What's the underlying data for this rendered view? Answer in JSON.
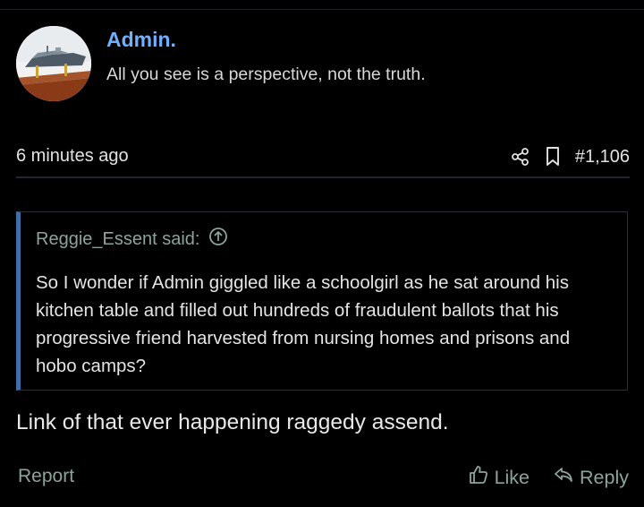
{
  "author": {
    "username": "Admin.",
    "user_title": "All you see is a perspective, not the truth."
  },
  "post": {
    "time": "6 minutes ago",
    "number": "#1,106",
    "icons": {
      "share": "share-icon",
      "bookmark": "bookmark-icon"
    }
  },
  "quote": {
    "attribution": "Reggie_Essent said:",
    "jump_icon": "arrow-up-circle-icon",
    "text": "So I wonder if Admin giggled like a schoolgirl as he sat around his kitchen table and filled out hundreds of fraudulent ballots that his progressive friend harvested from nursing homes and prisons and hobo camps?"
  },
  "message": "Link of that ever happening raggedy assend.",
  "footer": {
    "report_label": "Report",
    "like_label": "Like",
    "reply_label": "Reply",
    "icons": {
      "like": "thumbs-up-icon",
      "reply": "reply-icon"
    }
  },
  "colors": {
    "background": "#000000",
    "username": "#6fb0ff",
    "muted_link": "#8aa59a",
    "quote_accent": "#3f6fa9"
  }
}
